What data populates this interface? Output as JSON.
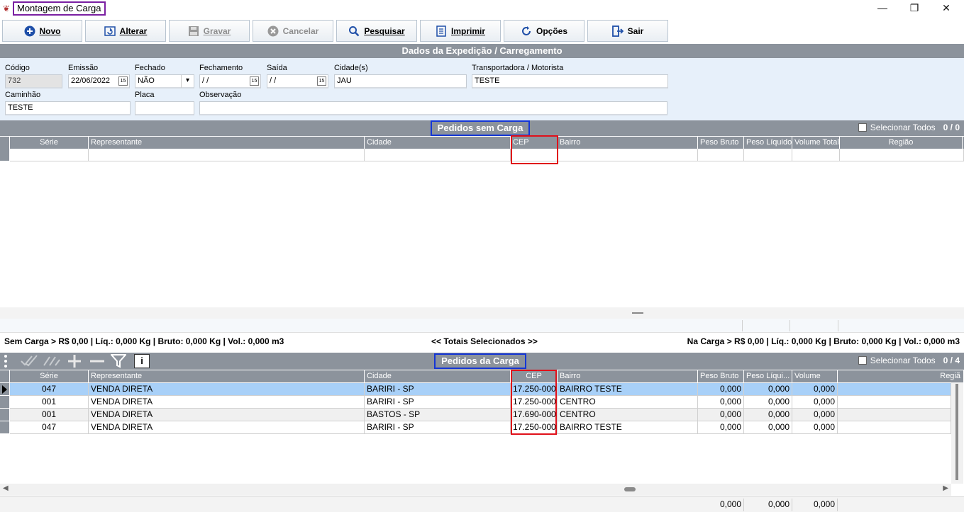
{
  "window": {
    "title": "Montagem de Carga",
    "controls": [
      "—",
      "❐",
      "✕"
    ]
  },
  "toolbar": {
    "novo": "Novo",
    "alterar": "Alterar",
    "gravar": "Gravar",
    "cancelar": "Cancelar",
    "pesquisar": "Pesquisar",
    "imprimir": "Imprimir",
    "opcoes": "Opções",
    "sair": "Sair"
  },
  "form": {
    "section_title": "Dados da Expedição / Carregamento",
    "codigo_label": "Código",
    "codigo_value": "732",
    "emissao_label": "Emissão",
    "emissao_value": "22/06/2022",
    "fechado_label": "Fechado",
    "fechado_value": "NÃO",
    "fechamento_label": "Fechamento",
    "fechamento_value": " / /",
    "saida_label": "Saída",
    "saida_value": " / /",
    "cidades_label": "Cidade(s)",
    "cidades_value": "JAU",
    "transportadora_label": "Transportadora / Motorista",
    "transportadora_value": "TESTE",
    "caminhao_label": "Caminhão",
    "caminhao_value": "TESTE",
    "placa_label": "Placa",
    "placa_value": "",
    "observacao_label": "Observação",
    "observacao_value": ""
  },
  "sem_carga": {
    "title": "Pedidos sem Carga",
    "select_all": "Selecionar Todos",
    "count": "0 / 0",
    "columns": [
      "Série",
      "Representante",
      "Cidade",
      "CEP",
      "Bairro",
      "Peso Bruto",
      "Peso Líquido",
      "Volume Total",
      "Região"
    ]
  },
  "summary": {
    "left": "Sem Carga > R$ 0,00 | Líq.: 0,000 Kg | Bruto: 0,000 Kg | Vol.: 0,000 m3",
    "center": "<< Totais Selecionados >>",
    "right": "Na Carga > R$ 0,00 | Líq.: 0,000 Kg | Bruto: 0,000 Kg | Vol.: 0,000 m3"
  },
  "da_carga": {
    "title": "Pedidos da Carga",
    "select_all": "Selecionar Todos",
    "count": "0 / 4",
    "columns": [
      "Série",
      "Representante",
      "Cidade",
      "CEP",
      "Bairro",
      "Peso Bruto",
      "Peso Líqui...",
      "Volume",
      "Regiã"
    ],
    "rows": [
      {
        "serie": "047",
        "representante": "VENDA DIRETA",
        "cidade": "BARIRI - SP",
        "cep": "17.250-000",
        "bairro": "BAIRRO TESTE",
        "peso_bruto": "0,000",
        "peso_liquido": "0,000",
        "volume": "0,000",
        "regiao": ""
      },
      {
        "serie": "001",
        "representante": "VENDA DIRETA",
        "cidade": "BARIRI - SP",
        "cep": "17.250-000",
        "bairro": "CENTRO",
        "peso_bruto": "0,000",
        "peso_liquido": "0,000",
        "volume": "0,000",
        "regiao": ""
      },
      {
        "serie": "001",
        "representante": "VENDA DIRETA",
        "cidade": "BASTOS - SP",
        "cep": "17.690-000",
        "bairro": "CENTRO",
        "peso_bruto": "0,000",
        "peso_liquido": "0,000",
        "volume": "0,000",
        "regiao": ""
      },
      {
        "serie": "047",
        "representante": "VENDA DIRETA",
        "cidade": "BARIRI - SP",
        "cep": "17.250-000",
        "bairro": "BAIRRO TESTE",
        "peso_bruto": "0,000",
        "peso_liquido": "0,000",
        "volume": "0,000",
        "regiao": ""
      }
    ],
    "totals": {
      "peso_bruto": "0,000",
      "peso_liquido": "0,000",
      "volume": "0,000"
    }
  },
  "colors": {
    "header_gray": "#8c939c",
    "form_bg": "#e7f0fa",
    "selected_row": "#a8d0f8",
    "highlight_red": "#e0101a",
    "highlight_blue": "#1436d6",
    "highlight_purple": "#7a1fa2"
  }
}
